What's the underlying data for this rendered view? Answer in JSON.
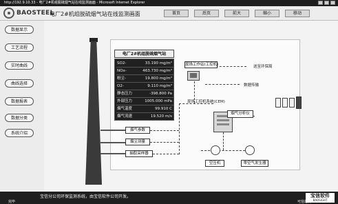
{
  "window": {
    "title": "http://192.9.10.33 - 电厂2#机组脱硫烟气站在线监测画面 - Microsoft Internet Explorer"
  },
  "header": {
    "brand": "BAOSTEEL",
    "title": "电厂2#机组脱硫烟气站在线监测画面",
    "nav": [
      "首页",
      "后页",
      "前大",
      "缩小",
      "移动"
    ]
  },
  "sidebar": {
    "items": [
      {
        "label": "数据显示"
      },
      {
        "label": "工艺流程"
      },
      {
        "label": "实时曲线"
      },
      {
        "label": "曲线选择"
      },
      {
        "label": "数据报表"
      },
      {
        "label": "数据分类"
      },
      {
        "label": "系统介绍"
      }
    ]
  },
  "panel": {
    "title": "电厂2#机组脱硫烟气站",
    "rows": [
      {
        "label": "SO2-",
        "value": "33.190 mg/m³"
      },
      {
        "label": "NOx-",
        "value": "463.730 mg/m³"
      },
      {
        "label": "粉尘-",
        "value": "19.800 mg/m³"
      },
      {
        "label": "O2-",
        "value": "9.110 mg/m³"
      },
      {
        "label": "静态压力",
        "value": "-398.800 Pa"
      },
      {
        "label": "外部压力",
        "value": "1005.000 mPa"
      },
      {
        "label": "烟气温度",
        "value": "99.910 C"
      },
      {
        "label": "烟气流速",
        "value": "19.520 m/s"
      }
    ]
  },
  "diagram": {
    "labels": {
      "sample_unit": "烟气参数",
      "flow_unit": "烟尘测量",
      "probe_unit": "抽取采样器",
      "workstation": "现场工作站(工控机)",
      "data_proc": "数据传输",
      "remote": "送至环保局",
      "site_station": "现场工控机系统(CEM)",
      "analyzer": "烟气分析仪",
      "compressor": "空压机",
      "gas_gen": "零空气发生器"
    }
  },
  "status": {
    "note": "宝信分公司环保监测系统，由宝信软件公司开发。",
    "done": "完毕",
    "zone": "可信站点"
  },
  "watermark": {
    "line1": "宝信软件",
    "line2": "BAOSIGHT"
  }
}
